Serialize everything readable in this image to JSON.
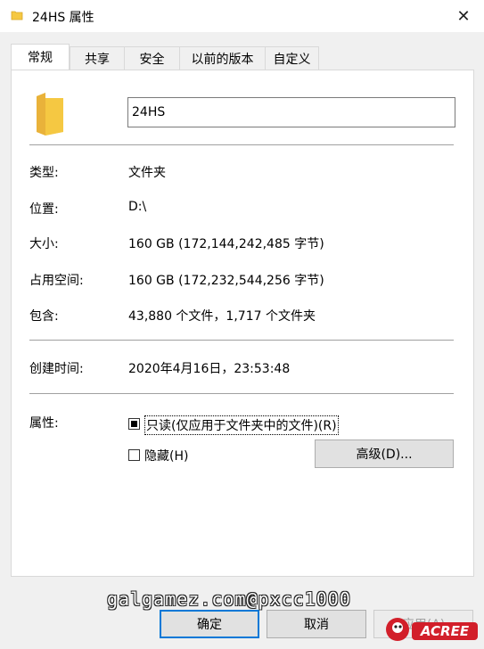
{
  "window": {
    "title": "24HS 属性",
    "close": "✕"
  },
  "tabs": [
    "常规",
    "共享",
    "安全",
    "以前的版本",
    "自定义"
  ],
  "general": {
    "name_value": "24HS",
    "type_label": "类型:",
    "type_value": "文件夹",
    "location_label": "位置:",
    "location_value": "D:\\",
    "size_label": "大小:",
    "size_value": "160 GB (172,144,242,485 字节)",
    "disk_size_label": "占用空间:",
    "disk_size_value": "160 GB (172,232,544,256 字节)",
    "contains_label": "包含:",
    "contains_value": "43,880 个文件，1,717 个文件夹",
    "created_label": "创建时间:",
    "created_value": "2020年4月16日，23:53:48",
    "attributes_label": "属性:",
    "readonly_label": "只读(仅应用于文件夹中的文件)(R)",
    "readonly_state": "indeterminate",
    "hidden_label": "隐藏(H)",
    "hidden_checked": false,
    "advanced_button": "高级(D)..."
  },
  "buttons": {
    "ok": "确定",
    "cancel": "取消",
    "apply": "应用(A)"
  },
  "overlay": {
    "watermark": "galgamez.com@pxcc1000",
    "logo_text": "ACREE"
  },
  "colors": {
    "folder": "#f5c842",
    "accent": "#0078d7",
    "logo": "#d21f2a"
  }
}
